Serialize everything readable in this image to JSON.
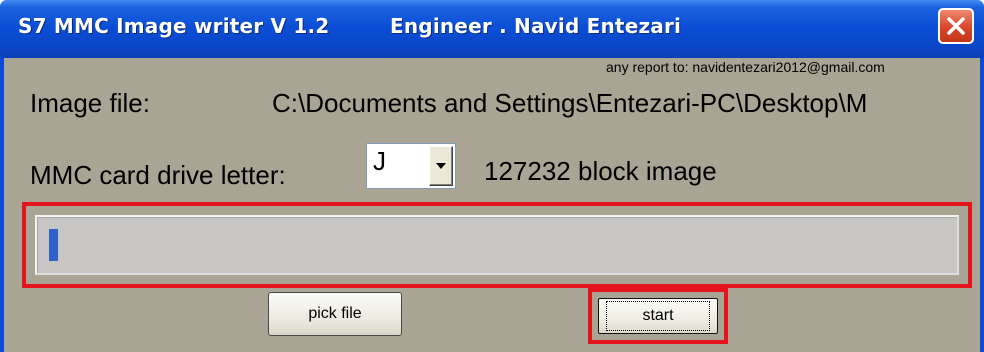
{
  "window": {
    "title": "S7 MMC Image writer V 1.2",
    "subtitle": "Engineer . Navid Entezari"
  },
  "report": {
    "text": "any report to: navidentezari2012@gmail.com"
  },
  "image_file": {
    "label": "Image file:",
    "path": "C:\\Documents and Settings\\Entezari-PC\\Desktop\\M"
  },
  "drive": {
    "label": "MMC card drive letter:",
    "selected": "J"
  },
  "blocks": {
    "text": "127232 block image"
  },
  "progress": {
    "fraction": 0.01,
    "color": "#2f62c6"
  },
  "buttons": {
    "pick_file": "pick file",
    "start": "start"
  },
  "colors": {
    "titlebar": "#0a4ad8",
    "client": "#a9a493",
    "highlight": "#e4141c",
    "close": "#d9462a"
  }
}
